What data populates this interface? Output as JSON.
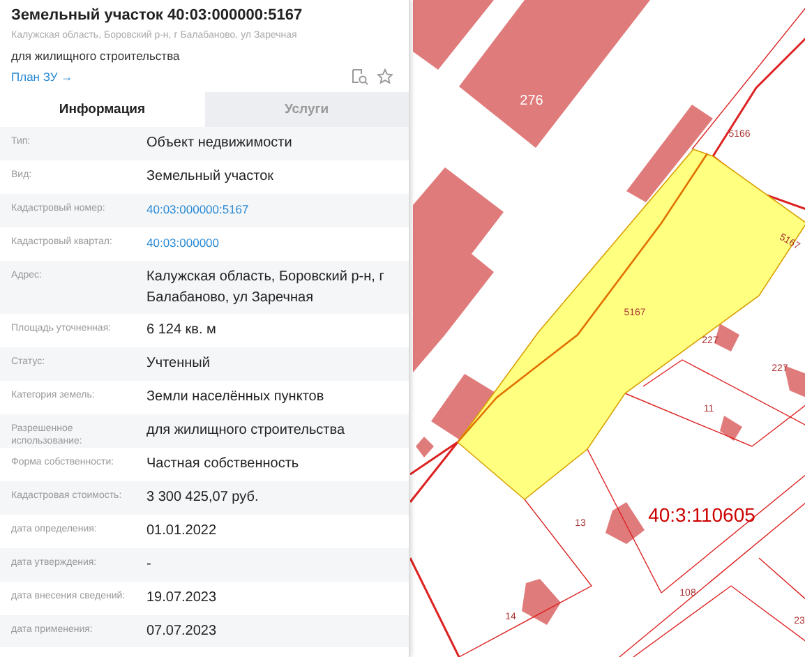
{
  "card": {
    "title": "Земельный участок 40:03:000000:5167",
    "address": "Калужская область, Боровский р-н, г Балабаново, ул Заречная",
    "purpose": "для жилищного строительства",
    "plan_link": "План ЗУ →"
  },
  "tabs": [
    {
      "label": "Информация",
      "selected": true
    },
    {
      "label": "Услуги",
      "selected": false
    }
  ],
  "properties": [
    {
      "label": "Тип:",
      "value": "Объект недвижимости",
      "kind": "text"
    },
    {
      "label": "Вид:",
      "value": "Земельный участок",
      "kind": "text"
    },
    {
      "label": "Кадастровый номер:",
      "value": "40:03:000000:5167",
      "kind": "link"
    },
    {
      "label": "Кадастровый квартал:",
      "value": "40:03:000000",
      "kind": "link"
    },
    {
      "label": "Адрес:",
      "value": "Калужская область, Боровский р-н, г Балабаново, ул Заречная",
      "kind": "text"
    },
    {
      "label": "Площадь уточненная:",
      "value": "6 124 кв. м",
      "kind": "text"
    },
    {
      "label": "Статус:",
      "value": "Учтенный",
      "kind": "text"
    },
    {
      "label": "Категория земель:",
      "value": "Земли населённых пунктов",
      "kind": "text"
    },
    {
      "label": "Разрешенное использование:",
      "value": "для жилищного строительства",
      "kind": "text"
    },
    {
      "label": "Форма собственности:",
      "value": "Частная собственность",
      "kind": "text"
    },
    {
      "label": "Кадастровая стоимость:",
      "value": "3 300 425,07 руб.",
      "kind": "text"
    },
    {
      "label": "дата определения:",
      "value": "01.01.2022",
      "kind": "text"
    },
    {
      "label": "дата утверждения:",
      "value": "-",
      "kind": "text"
    },
    {
      "label": "дата внесения сведений:",
      "value": "19.07.2023",
      "kind": "text"
    },
    {
      "label": "дата применения:",
      "value": "07.07.2023",
      "kind": "text"
    }
  ],
  "map": {
    "labels": [
      "276",
      "5166",
      "5167",
      "5167",
      "227",
      "227",
      "11",
      "13",
      "40:3:110605",
      "108",
      "14",
      "23"
    ]
  }
}
